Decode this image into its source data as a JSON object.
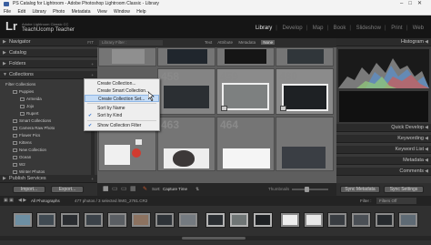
{
  "window": {
    "title": "PS Catalog for Lightroom - Adobe Photoshop Lightroom Classic - Library",
    "controls": [
      "–",
      "□",
      "✕"
    ]
  },
  "menubar": [
    "File",
    "Edit",
    "Library",
    "Photo",
    "Metadata",
    "View",
    "Window",
    "Help"
  ],
  "identity": {
    "logo": "Lr",
    "subtitle": "Adobe Lightroom Classic CC",
    "user": "TeachUcomp Teacher"
  },
  "modules": [
    "Library",
    "Develop",
    "Map",
    "Book",
    "Slideshow",
    "Print",
    "Web"
  ],
  "active_module": "Library",
  "left_panel": {
    "sections": [
      "Navigator",
      "Catalog",
      "Folders",
      "Collections"
    ],
    "navigator_right": "FIT",
    "collections_add": "+",
    "tree": [
      {
        "label": "Filter Collections",
        "indent": 0
      },
      {
        "label": "Puppies",
        "indent": 1
      },
      {
        "label": "Armeida",
        "indent": 2
      },
      {
        "label": "Jojo",
        "indent": 2
      },
      {
        "label": "Rupert",
        "indent": 2
      },
      {
        "label": "Smart Collections",
        "indent": 1
      },
      {
        "label": "Camera Raw Photo",
        "indent": 1
      },
      {
        "label": "Flower Pics",
        "indent": 1
      },
      {
        "label": "Kittens",
        "indent": 1
      },
      {
        "label": "New Collection",
        "indent": 1
      },
      {
        "label": "Ocean",
        "indent": 1
      },
      {
        "label": "W2",
        "indent": 1
      },
      {
        "label": "Winter Photos",
        "indent": 1
      }
    ],
    "publish": "Publish Services"
  },
  "grid": {
    "filter_label": "Library Filter :",
    "filters": [
      "Text",
      "Attribute",
      "Metadata",
      "None"
    ],
    "active_filter": "None",
    "cell_numbers": [
      "457",
      "458",
      "459",
      "460",
      "463",
      "464"
    ]
  },
  "context_menu": {
    "items": [
      {
        "label": "Create Collection...",
        "check": ""
      },
      {
        "label": "Create Smart Collection...",
        "check": ""
      },
      {
        "label": "Create Collection Set...",
        "check": ""
      },
      {
        "label": "Sort by Name",
        "check": ""
      },
      {
        "label": "Sort by Kind",
        "check": "✔"
      },
      {
        "label": "Show Collection Filter",
        "check": "✔"
      }
    ],
    "highlighted": "Create Collection Set..."
  },
  "right_panel": {
    "histogram": "Histogram",
    "sections": [
      "Quick Develop",
      "Keywording",
      "Keyword List",
      "Metadata",
      "Comments"
    ]
  },
  "bottom": {
    "import": "Import...",
    "export": "Export...",
    "sort_label": "Sort:",
    "sort_value": "Capture Time",
    "thumbnails": "Thumbnails",
    "sync_metadata": "Sync Metadata",
    "sync_settings": "Sync Settings"
  },
  "filmstrip": {
    "source": "All Photographs",
    "info": "477 photos / 3 selected /IMG_2781.CR2",
    "filter_label": "Filter :",
    "filter_value": "Filters Off"
  },
  "colors": {
    "accent": "#c5dcf6",
    "panel": "#383838",
    "grid": "#5e5e5e"
  }
}
